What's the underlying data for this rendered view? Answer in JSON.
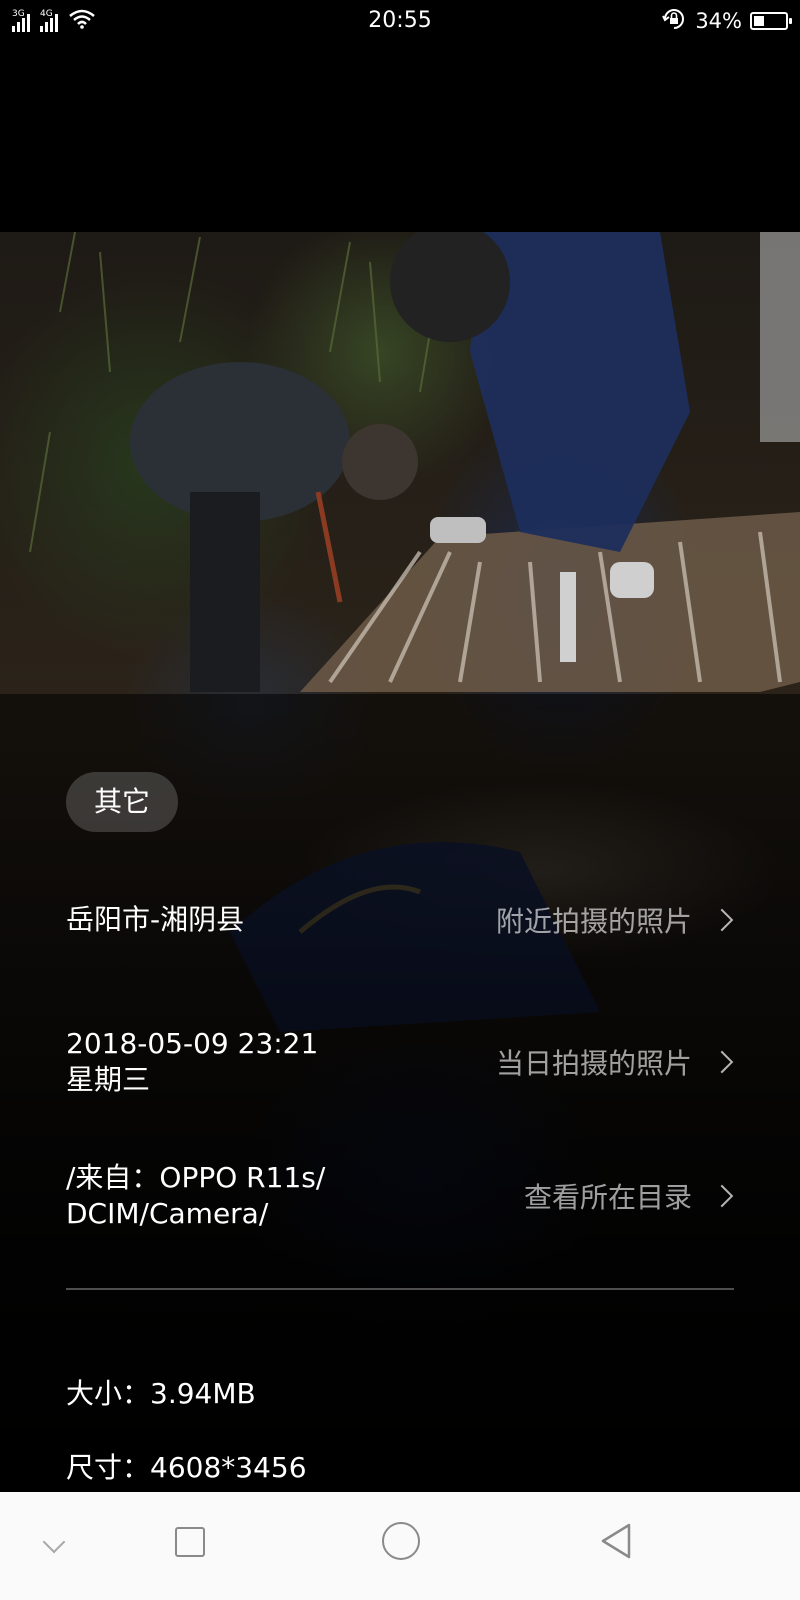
{
  "status_bar": {
    "signal_1_label": "3G",
    "signal_2_label": "4G",
    "time": "20:55",
    "battery_percent": "34%",
    "battery_level": 0.34,
    "icons": [
      "signal-3g-icon",
      "signal-4g-icon",
      "wifi-icon",
      "rotation-lock-icon",
      "battery-icon"
    ]
  },
  "info": {
    "category_chip": "其它",
    "location": {
      "label": "岳阳市-湘阴县",
      "action": "附近拍摄的照片"
    },
    "datetime": {
      "date_line": "2018-05-09 23:21",
      "weekday_line": "星期三",
      "action": "当日拍摄的照片"
    },
    "path": {
      "line1": "/来自：OPPO R11s/",
      "line2": "DCIM/Camera/",
      "action": "查看所在目录"
    },
    "size": "大小：3.94MB",
    "dimensions": "尺寸：4608*3456"
  },
  "nav_bar": {
    "icons": [
      "collapse-chevron-icon",
      "recents-icon",
      "home-icon",
      "back-icon"
    ]
  }
}
